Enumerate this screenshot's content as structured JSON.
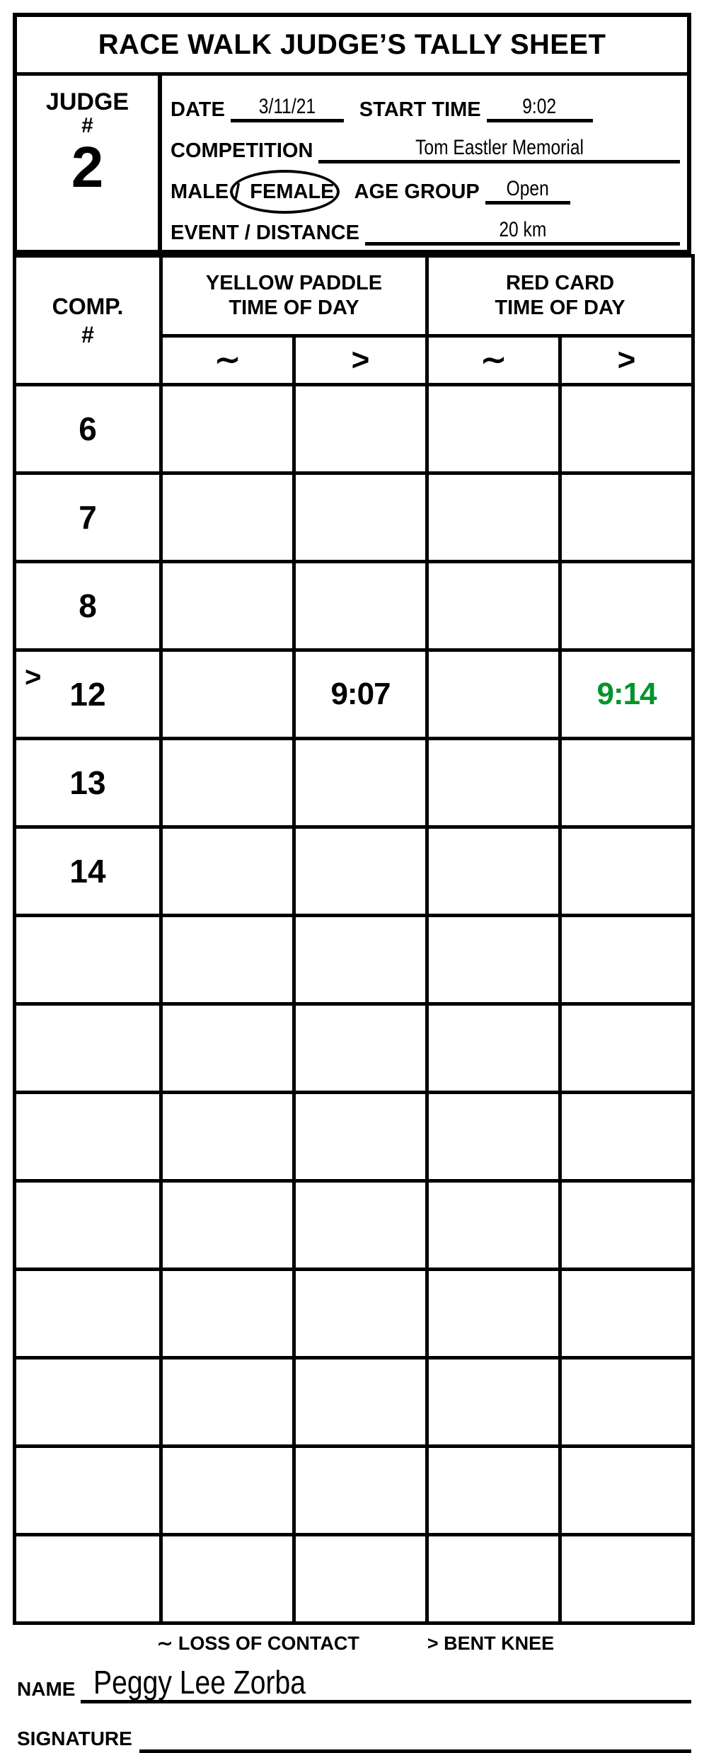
{
  "title": "RACE WALK JUDGE’S TALLY SHEET",
  "judge": {
    "label": "JUDGE",
    "hash": "#",
    "number": "2"
  },
  "info": {
    "date_label": "DATE",
    "date_value": "3/11/21",
    "start_time_label": "START TIME",
    "start_time_value": "9:02",
    "competition_label": "COMPETITION",
    "competition_value": "Tom Eastler Memorial",
    "male_label": "MALE /",
    "female_label": "FEMALE",
    "gender_selected": "FEMALE",
    "age_group_label": "AGE GROUP",
    "age_group_value": "Open",
    "event_label": "EVENT / DISTANCE",
    "event_value": "20 km"
  },
  "table": {
    "comp_header_line1": "COMP.",
    "comp_header_line2": "#",
    "group_yellow_line1": "YELLOW PADDLE",
    "group_yellow_line2": "TIME OF DAY",
    "group_red_line1": "RED CARD",
    "group_red_line2": "TIME OF DAY",
    "sym_loss_of_contact": "∼",
    "sym_bent_knee": ">",
    "red_card_color": "#00952a",
    "rows": [
      {
        "comp": "6",
        "mark": "",
        "yellow_contact": "",
        "yellow_knee": "",
        "red_contact": "",
        "red_knee": ""
      },
      {
        "comp": "7",
        "mark": "",
        "yellow_contact": "",
        "yellow_knee": "",
        "red_contact": "",
        "red_knee": ""
      },
      {
        "comp": "8",
        "mark": "",
        "yellow_contact": "",
        "yellow_knee": "",
        "red_contact": "",
        "red_knee": ""
      },
      {
        "comp": "12",
        "mark": ">",
        "yellow_contact": "",
        "yellow_knee": "9:07",
        "red_contact": "",
        "red_knee": "9:14"
      },
      {
        "comp": "13",
        "mark": "",
        "yellow_contact": "",
        "yellow_knee": "",
        "red_contact": "",
        "red_knee": ""
      },
      {
        "comp": "14",
        "mark": "",
        "yellow_contact": "",
        "yellow_knee": "",
        "red_contact": "",
        "red_knee": ""
      },
      {
        "comp": "",
        "mark": "",
        "yellow_contact": "",
        "yellow_knee": "",
        "red_contact": "",
        "red_knee": ""
      },
      {
        "comp": "",
        "mark": "",
        "yellow_contact": "",
        "yellow_knee": "",
        "red_contact": "",
        "red_knee": ""
      },
      {
        "comp": "",
        "mark": "",
        "yellow_contact": "",
        "yellow_knee": "",
        "red_contact": "",
        "red_knee": ""
      },
      {
        "comp": "",
        "mark": "",
        "yellow_contact": "",
        "yellow_knee": "",
        "red_contact": "",
        "red_knee": ""
      },
      {
        "comp": "",
        "mark": "",
        "yellow_contact": "",
        "yellow_knee": "",
        "red_contact": "",
        "red_knee": ""
      },
      {
        "comp": "",
        "mark": "",
        "yellow_contact": "",
        "yellow_knee": "",
        "red_contact": "",
        "red_knee": ""
      },
      {
        "comp": "",
        "mark": "",
        "yellow_contact": "",
        "yellow_knee": "",
        "red_contact": "",
        "red_knee": ""
      },
      {
        "comp": "",
        "mark": "",
        "yellow_contact": "",
        "yellow_knee": "",
        "red_contact": "",
        "red_knee": ""
      }
    ]
  },
  "footer": {
    "legend_contact": "∼ LOSS OF CONTACT",
    "legend_knee": "> BENT KNEE",
    "name_label": "NAME",
    "name_value": "Peggy Lee Zorba",
    "signature_label": "SIGNATURE",
    "signature_value": ""
  }
}
